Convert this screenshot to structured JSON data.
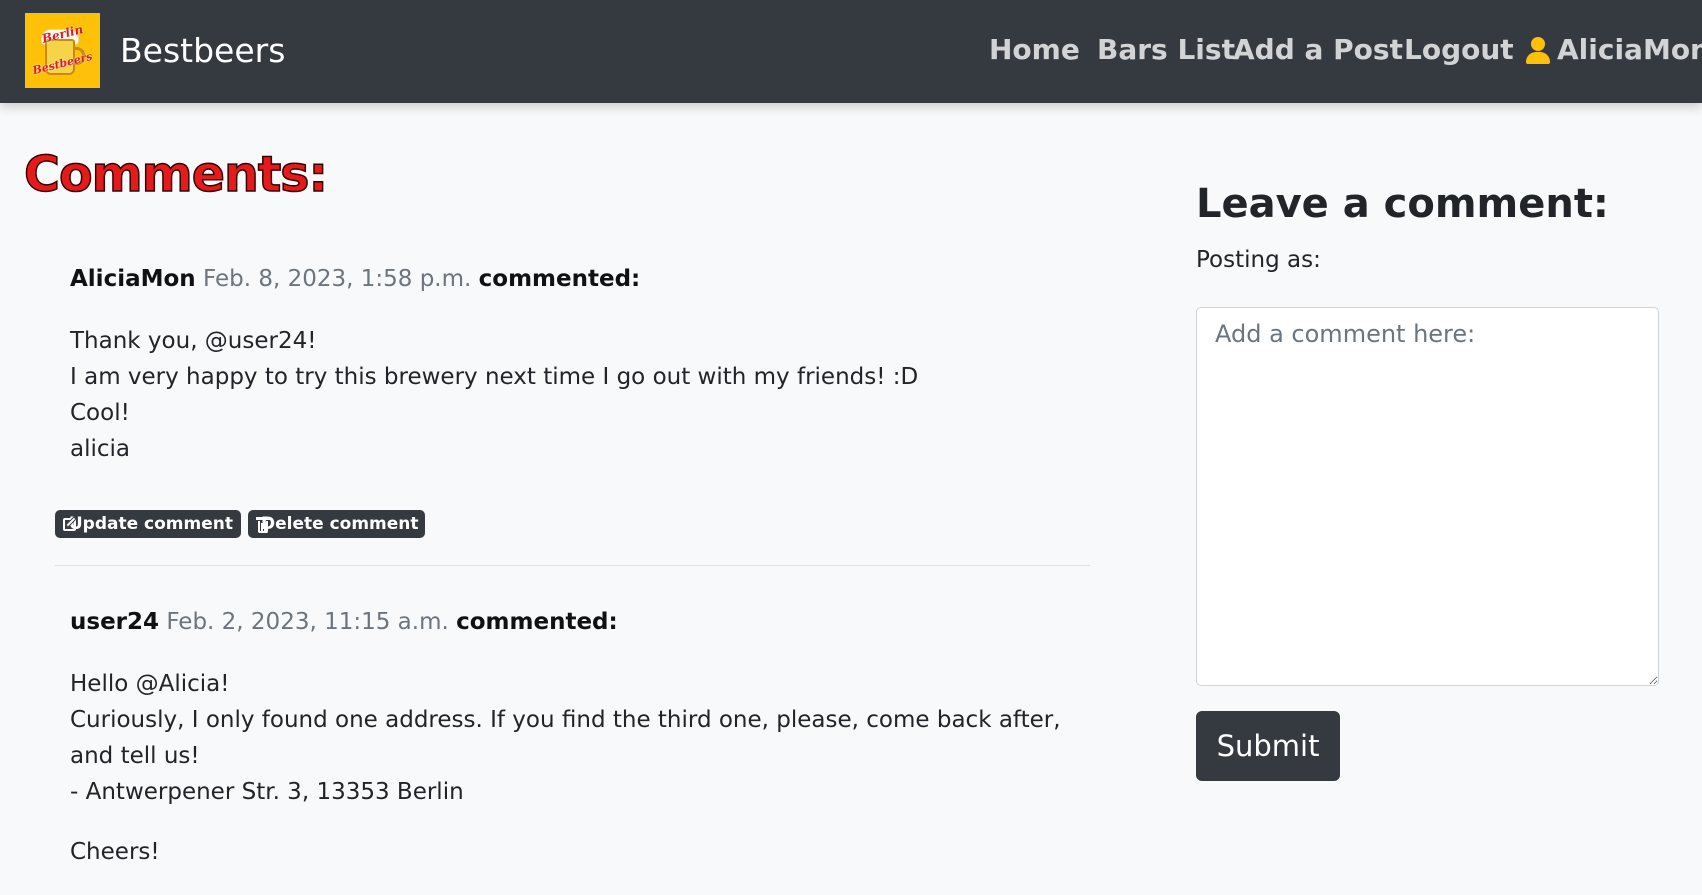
{
  "navbar": {
    "logo_text_top": "Berlin",
    "logo_text_bottom": "Bestbeers",
    "brand": "Bestbeers",
    "links": {
      "home": "Home",
      "bars_list": "Bars List",
      "add_post": "Add a Post",
      "logout": "Logout",
      "user": "AliciaMon"
    },
    "accent_color": "#ffc107"
  },
  "comments_section": {
    "heading": "Comments:",
    "comments": [
      {
        "author": "AliciaMon",
        "date": "Feb. 8, 2023, 1:58 p.m.",
        "verb": "commented:",
        "lines": [
          "Thank you, @user24!",
          "I am very happy to try this brewery next time I go out with my friends! :D",
          "Cool!",
          "alicia"
        ],
        "update_label": "Update comment",
        "delete_label": "Delete comment"
      },
      {
        "author": "user24",
        "date": "Feb. 2, 2023, 11:15 a.m.",
        "verb": "commented:",
        "lines": [
          "Hello @Alicia!",
          "Curiously, I only found one address. If you find the third one, please, come back after, and tell us!",
          "- Antwerpener Str. 3, 13353 Berlin"
        ],
        "closing": "Cheers!"
      }
    ]
  },
  "leave_comment": {
    "heading": "Leave a comment:",
    "posting_as": "Posting as:",
    "placeholder": "Add a comment here:",
    "value": "",
    "submit_label": "Submit"
  }
}
